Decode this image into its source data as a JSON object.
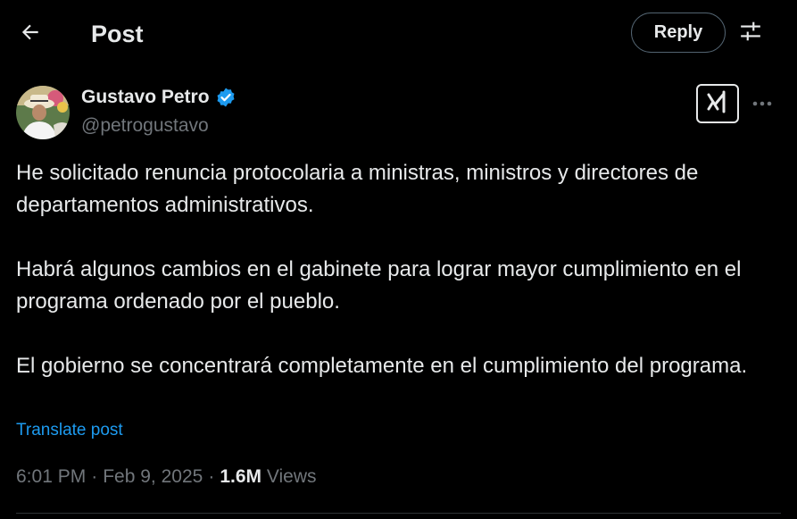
{
  "header": {
    "title": "Post",
    "reply_label": "Reply",
    "back_icon": "arrow-left-icon",
    "settings_icon": "sliders-icon"
  },
  "author": {
    "name": "Gustavo Petro",
    "handle": "@petrogustavo",
    "verified": true,
    "verified_color": "#1d9bf0"
  },
  "post": {
    "paragraphs": [
      "He solicitado renuncia protocolaria a ministras, ministros y directores de departamentos administrativos.",
      "Habrá algunos cambios en el gabinete para lograr mayor cumplimiento en el programa ordenado por el pueblo.",
      "El gobierno se concentrará completamente en el cumplimiento del programa."
    ],
    "translate_label": "Translate post",
    "time": "6:01 PM",
    "separator": "·",
    "date": "Feb 9, 2025",
    "views_count": "1.6M",
    "views_label": "Views"
  },
  "colors": {
    "background": "#000000",
    "text_primary": "#e7e9ea",
    "text_secondary": "#71767b",
    "accent": "#1d9bf0",
    "border": "#536471"
  }
}
